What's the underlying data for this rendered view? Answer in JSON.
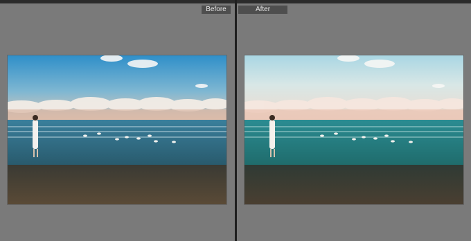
{
  "compare": {
    "before_label": "Before",
    "after_label": "After"
  },
  "colors": {
    "app_background": "#7a7a7a",
    "divider": "#1f1f1f",
    "label_background": "#4e4e4e",
    "label_text": "#e6e6e6"
  }
}
